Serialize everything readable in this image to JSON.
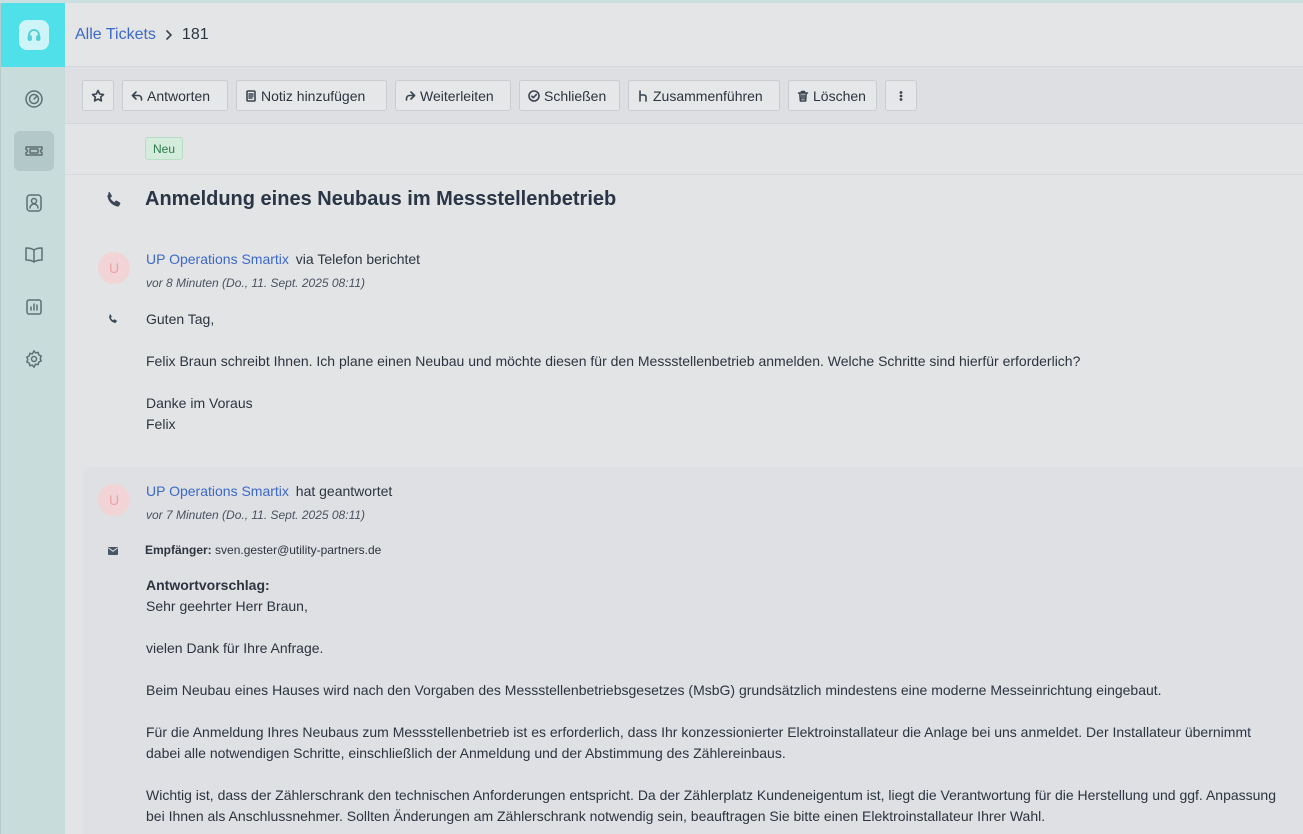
{
  "breadcrumb": {
    "root": "Alle Tickets",
    "current": "181"
  },
  "sidebar": {
    "items": [
      {
        "name": "dashboard",
        "icon": "dashboard-gauge-icon",
        "active": false
      },
      {
        "name": "tickets",
        "icon": "ticket-icon",
        "active": true
      },
      {
        "name": "contacts",
        "icon": "contact-icon",
        "active": false
      },
      {
        "name": "knowledge-base",
        "icon": "book-icon",
        "active": false
      },
      {
        "name": "reports",
        "icon": "bar-chart-icon",
        "active": false
      },
      {
        "name": "settings",
        "icon": "gear-icon",
        "active": false
      }
    ]
  },
  "toolbar": {
    "star": "star-icon",
    "reply": "Antworten",
    "note": "Notiz hinzufügen",
    "forward": "Weiterleiten",
    "close": "Schließen",
    "merge": "Zusammenführen",
    "delete": "Löschen",
    "more": "more-vertical-icon"
  },
  "ticket": {
    "status": "Neu",
    "title": "Anmeldung eines Neubaus im Messstellenbetrieb",
    "channel_icon": "phone-icon"
  },
  "messages": [
    {
      "avatar": "U",
      "author": "UP Operations Smartix",
      "action": "via Telefon berichtet",
      "time": "vor 8 Minuten (Do., 11. Sept. 2025 08:11)",
      "icon": "phone-icon",
      "greeting": "Guten Tag,",
      "body": "Felix Braun schreibt Ihnen. Ich plane einen Neubau und möchte diesen für den Messstellenbetrieb anmelden. Welche Schritte sind hierfür erforderlich?",
      "closing1": "Danke im Voraus",
      "closing2": "Felix"
    },
    {
      "avatar": "U",
      "author": "UP Operations Smartix",
      "action": "hat geantwortet",
      "time": "vor 7 Minuten (Do., 11. Sept. 2025 08:11)",
      "icon": "mail-icon",
      "recipient_label": "Empfänger:",
      "recipient": "sven.gester@utility-partners.de",
      "heading": "Antwortvorschlag:",
      "salutation": "Sehr geehrter Herr Braun,",
      "p1": "vielen Dank für Ihre Anfrage.",
      "p2": "Beim Neubau eines Hauses wird nach den Vorgaben des Messstellenbetriebsgesetzes (MsbG) grundsätzlich mindestens eine moderne Messeinrichtung eingebaut.",
      "p3": "Für die Anmeldung Ihres Neubaus zum Messstellenbetrieb ist es erforderlich, dass Ihr konzessionierter Elektroinstallateur die Anlage bei uns anmeldet. Der Installateur übernimmt dabei alle notwendigen Schritte, einschließlich der Anmeldung und der Abstimmung des Zählereinbaus.",
      "p4": "Wichtig ist, dass der Zählerschrank den technischen Anforderungen entspricht. Da der Zählerplatz Kundeneigentum ist, liegt die Verantwortung für die Herstellung und ggf. Anpassung bei Ihnen als Anschlussnehmer. Sollten Änderungen am Zählerschrank notwendig sein, beauftragen Sie bitte einen Elektroinstallateur Ihrer Wahl."
    }
  ]
}
